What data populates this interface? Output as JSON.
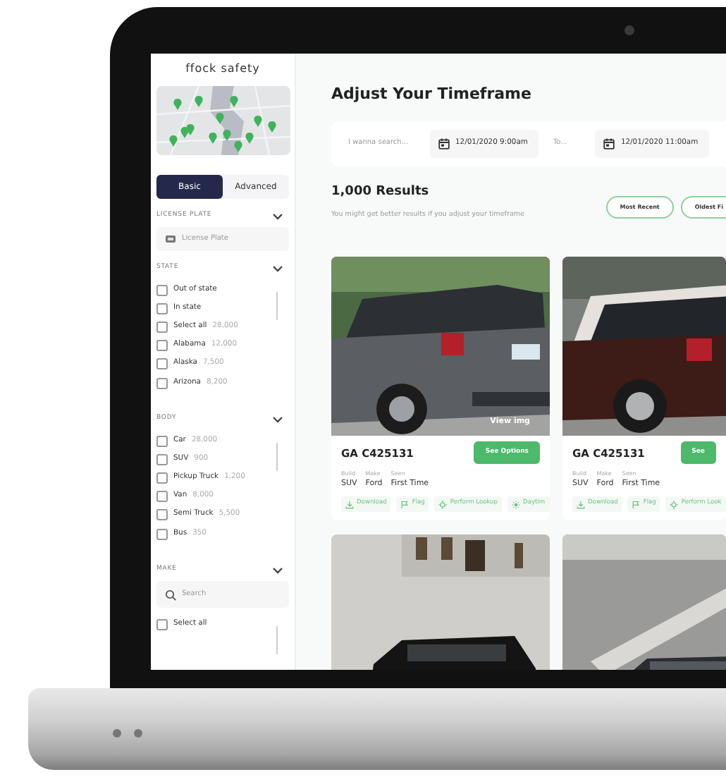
{
  "sidebar": {
    "logo": "ffock safety",
    "map": {
      "kind": "picture"
    },
    "tabs": [
      {
        "label": "Basic",
        "selected": true
      },
      {
        "label": "Advanced",
        "selected": false
      }
    ],
    "sections": [
      {
        "title": "LICENSE PLATE",
        "kind": "field",
        "field": {
          "placeholder": "License Plate"
        }
      },
      {
        "title": "STATE",
        "kind": "checklist",
        "items": [
          {
            "label": "Out of state",
            "checked": false
          },
          {
            "label": "In state",
            "checked": false
          },
          {
            "label": "Select all",
            "count": "28,000",
            "checked": false
          },
          {
            "label": "Alabama",
            "count": "12,000",
            "checked": false
          },
          {
            "label": "Alaska",
            "count": "7,500",
            "checked": false
          },
          {
            "label": "Arizona",
            "count": "8,200",
            "checked": false
          }
        ]
      },
      {
        "title": "BODY",
        "kind": "checklist",
        "items": [
          {
            "label": "Car",
            "count": "28,000",
            "checked": false
          },
          {
            "label": "SUV",
            "count": "900",
            "checked": false
          },
          {
            "label": "Pickup Truck",
            "count": "1,200",
            "checked": false
          },
          {
            "label": "Van",
            "count": "8,000",
            "checked": false
          },
          {
            "label": "Semi Truck",
            "count": "5,500",
            "checked": false
          },
          {
            "label": "Bus",
            "count": "350",
            "checked": false
          }
        ]
      },
      {
        "title": "MAKE",
        "kind": "search",
        "search": {
          "placeholder": "Search"
        },
        "items": [
          {
            "label": "Select all",
            "checked": false
          }
        ]
      }
    ]
  },
  "main": {
    "title": "Adjust Your Timeframe",
    "search": {
      "placeholder": "I wanna search...",
      "from": "12/01/2020 9:00am",
      "to_placeholder": "To...",
      "to": "12/01/2020 11:00am"
    },
    "results": {
      "title": "1,000 Results",
      "hint": "You might get better results if you adjust your timeframe"
    },
    "sort_buttons": [
      {
        "label": "Most Recent"
      },
      {
        "label": "Oldest Fi"
      }
    ],
    "cards": [
      {
        "photo": {
          "kind": "picture"
        },
        "view_label": "View img",
        "plate": "GA C425131",
        "button": "See Options",
        "specs": [
          {
            "label": "Build",
            "value": "SUV"
          },
          {
            "label": "Make",
            "value": "Ford"
          },
          {
            "label": "Seen",
            "value": "First Time"
          }
        ],
        "actions": [
          {
            "kind": "download",
            "label": "Download"
          },
          {
            "kind": "flag",
            "label": "Flag"
          },
          {
            "kind": "lookup",
            "label": "Perform Lookup"
          },
          {
            "kind": "day",
            "label": "Daytim"
          }
        ]
      },
      {
        "photo": {
          "kind": "picture"
        },
        "plate": "GA C425131",
        "button": "See",
        "specs": [
          {
            "label": "Build",
            "value": "SUV"
          },
          {
            "label": "Make",
            "value": "Ford"
          },
          {
            "label": "Seen",
            "value": "First Time"
          }
        ],
        "actions": [
          {
            "kind": "download",
            "label": "Download"
          },
          {
            "kind": "flag",
            "label": "Flag"
          },
          {
            "kind": "lookup",
            "label": "Perform Look"
          }
        ]
      },
      {
        "photo": {
          "kind": "picture"
        }
      },
      {
        "photo": {
          "kind": "picture"
        }
      }
    ]
  }
}
